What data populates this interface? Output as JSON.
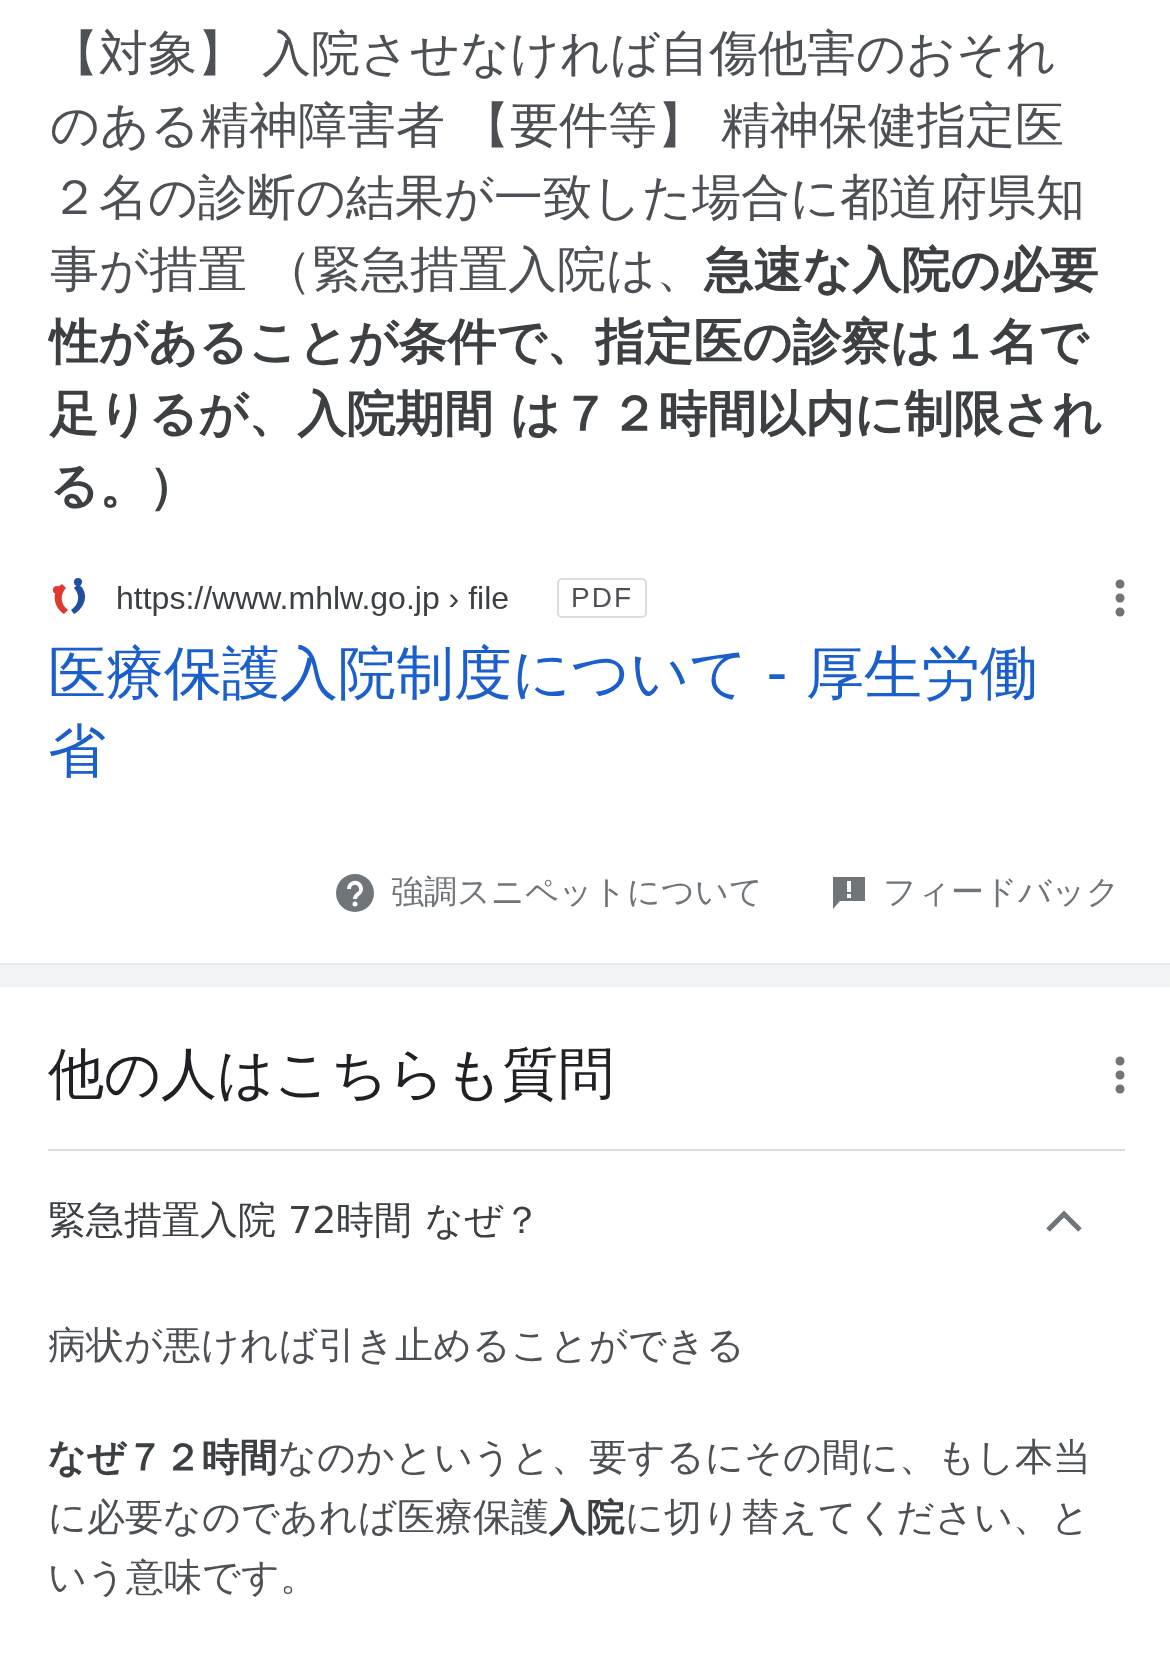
{
  "snippet": {
    "text": "【対象】 入院させなければ自傷他害のおそれのある精神障害者 【要件等】 精神保健指定医２名の診断の結果が一致した場合に都道府県知事が措置 （緊急措置入院は、**急速な入院の必要性があることが条件で、指定医の診察は１名で足りるが、入院期間 は７２時間以内に制限される。）**"
  },
  "source": {
    "url": "https://www.mhlw.go.jp › file",
    "format": "PDF",
    "title": "医療保護入院制度について - 厚生労働省"
  },
  "footer": {
    "about": "強調スニペットについて",
    "feedback": "フィードバック"
  },
  "related": {
    "heading": "他の人はこちらも質問",
    "questions": [
      {
        "question": "緊急措置入院 72時間 なぜ？",
        "expanded": true,
        "short_answer": "病状が悪ければ引き止めることができる",
        "answer": "**なぜ７２時間**なのかというと、要するにその間に、もし本当に必要なのであれば医療保護**入院**に切り替えてください、という意味です。"
      }
    ]
  }
}
